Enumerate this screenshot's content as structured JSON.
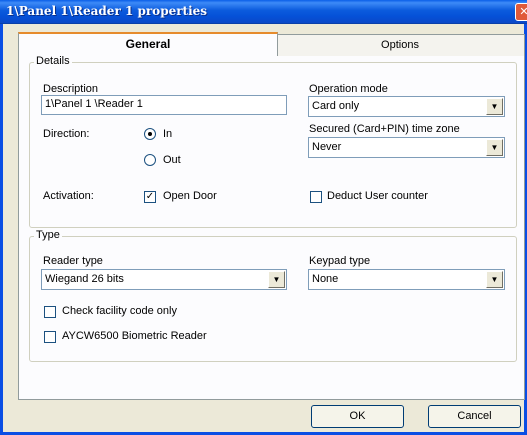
{
  "window": {
    "title": "1\\Panel 1\\Reader 1 properties",
    "close_symbol": "✕"
  },
  "tabs": [
    {
      "label": "General",
      "selected": true
    },
    {
      "label": "Options",
      "selected": false
    }
  ],
  "details": {
    "legend": "Details",
    "description_label": "Description",
    "description_value": "1\\Panel 1 \\Reader 1",
    "direction_label": "Direction:",
    "direction_options": [
      {
        "label": "In",
        "selected": true
      },
      {
        "label": "Out",
        "selected": false
      }
    ],
    "activation_label": "Activation:",
    "open_door": {
      "label": "Open Door",
      "checked": true
    },
    "operation_mode_label": "Operation mode",
    "operation_mode_value": "Card only",
    "secured_label": "Secured (Card+PIN)  time zone",
    "secured_value": "Never",
    "deduct_user_counter": {
      "label": "Deduct User counter",
      "checked": false
    }
  },
  "type": {
    "legend": "Type",
    "reader_type_label": "Reader type",
    "reader_type_value": "Wiegand 26 bits",
    "keypad_type_label": "Keypad type",
    "keypad_type_value": "None",
    "check_facility": {
      "label": "Check facility code only",
      "checked": false
    },
    "biometric": {
      "label": "AYCW6500 Biometric Reader",
      "checked": false
    }
  },
  "buttons": {
    "ok": "OK",
    "cancel": "Cancel"
  },
  "icons": {
    "combo_arrow": "▼",
    "checkmark": "✓"
  },
  "colors": {
    "titlebar": "#0A5FE8",
    "dialog_bg": "#ECE9D8",
    "panel_bg": "#FCFCFE",
    "tab_highlight": "#E68B2C"
  }
}
